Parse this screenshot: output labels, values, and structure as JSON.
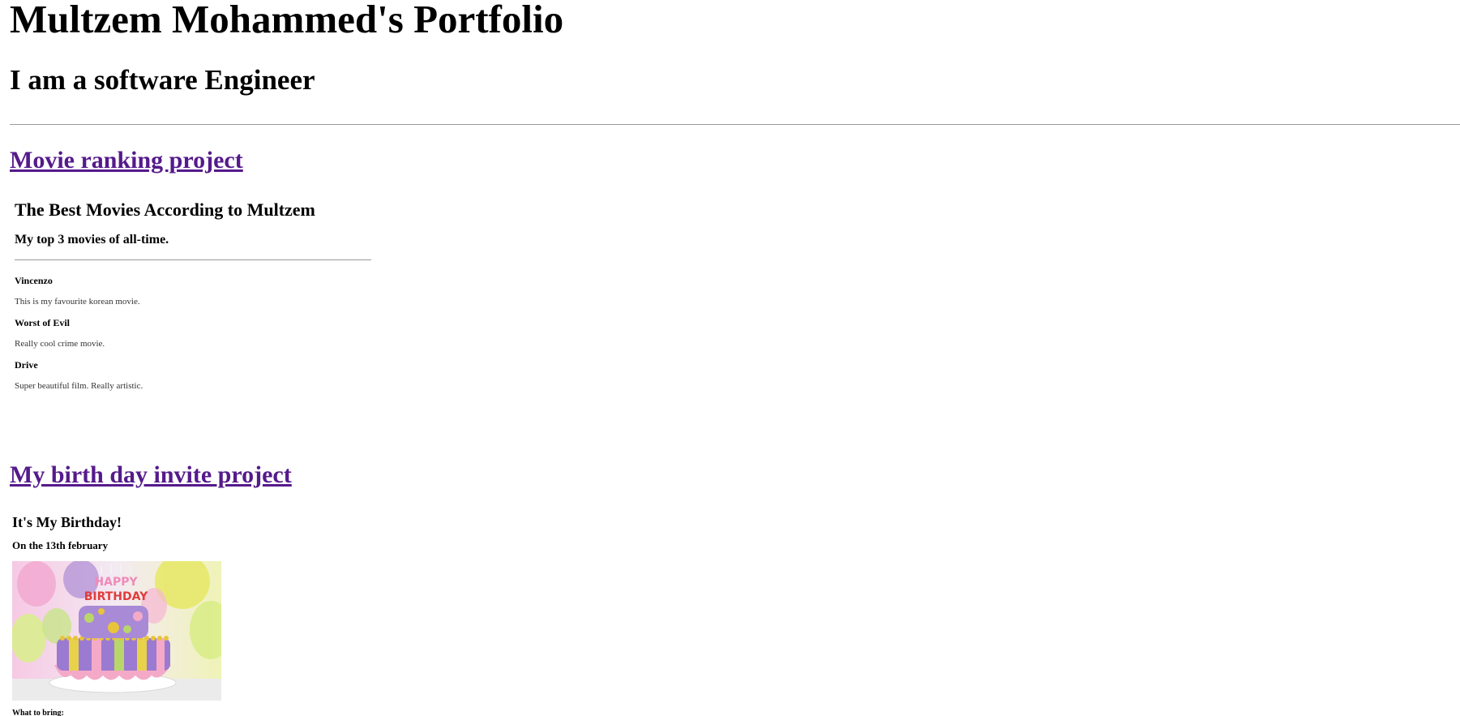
{
  "header": {
    "title": "Multzem Mohammed's Portfolio",
    "subtitle": "I am a software Engineer"
  },
  "projects": {
    "movie": {
      "link_label": "Movie ranking project",
      "page_title": "The Best Movies According to Multzem",
      "page_subtitle": "My top 3 movies of all-time.",
      "movies": [
        {
          "name": "Vincenzo",
          "description": "This is my favourite korean movie."
        },
        {
          "name": "Worst of Evil",
          "description": "Really cool crime movie."
        },
        {
          "name": "Drive",
          "description": "Super beautiful film. Really artistic."
        }
      ]
    },
    "birthday": {
      "link_label": "My birth day invite project",
      "page_title": "It's My Birthday!",
      "date_line": "On the 13th february",
      "image_subject": "birthday-cake-image",
      "cake_topper_text": "HAPPY BIRTHDAY",
      "bring_label": "What to bring:"
    }
  },
  "colors": {
    "visited_link": "#551a8b",
    "divider": "#9a9a9a",
    "cake_purple": "#9b7ad1",
    "cake_yellow": "#e8d24a",
    "cake_pink": "#f4a9c8"
  }
}
